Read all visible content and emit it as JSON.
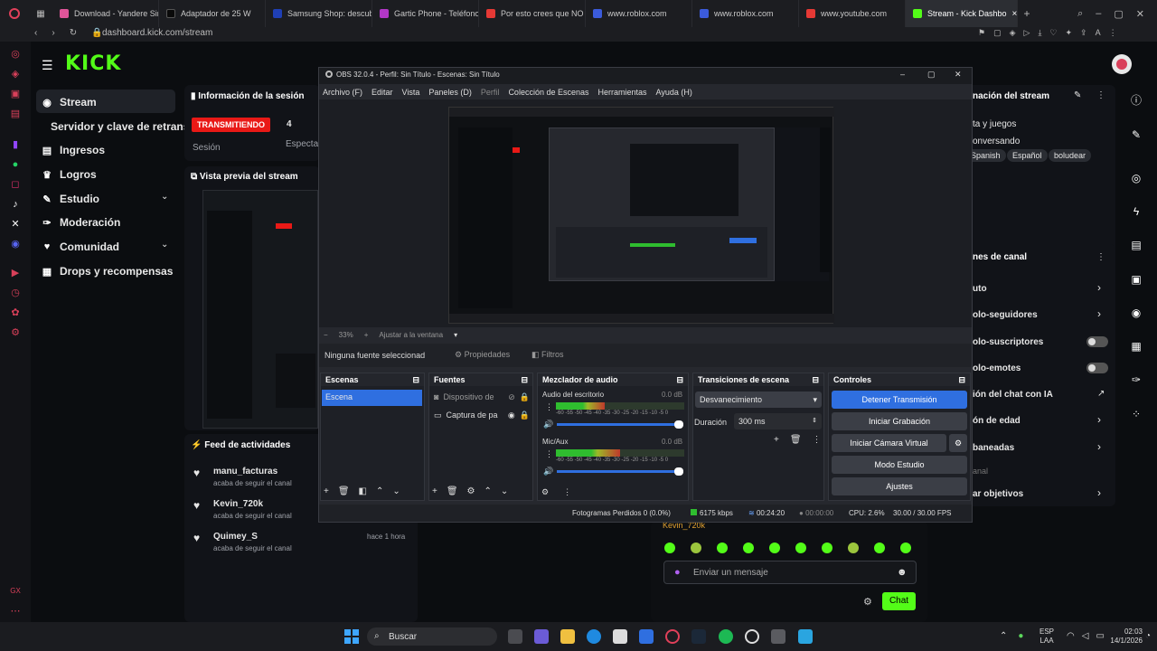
{
  "browser": {
    "tabs": [
      {
        "label": "Download - Yandere Sim",
        "color": "#e0559a"
      },
      {
        "label": "Adaptador de 25 W",
        "color": "#0a0a0a"
      },
      {
        "label": "Samsung Shop: descubr",
        "color": "#1f3fb5"
      },
      {
        "label": "Gartic Phone - Teléfono",
        "color": "#b237c7"
      },
      {
        "label": "Por esto crees que NO l",
        "color": "#e53935"
      },
      {
        "label": "www.roblox.com",
        "color": "#3b5bdb"
      },
      {
        "label": "www.roblox.com",
        "color": "#3b5bdb"
      },
      {
        "label": "www.youtube.com",
        "color": "#e53935"
      },
      {
        "label": "Stream - Kick Dashbo",
        "color": "#53fc18"
      }
    ],
    "url": "dashboard.kick.com/stream"
  },
  "kick": {
    "logo": "KICK",
    "nav": [
      {
        "label": "Stream",
        "icon": "broadcast-icon"
      },
      {
        "label": "Servidor y clave de retransm",
        "icon": ""
      },
      {
        "label": "Ingresos",
        "icon": "dollar-icon"
      },
      {
        "label": "Logros",
        "icon": "trophy-icon"
      },
      {
        "label": "Estudio",
        "icon": "pencil-icon"
      },
      {
        "label": "Moderación",
        "icon": "wrench-icon"
      },
      {
        "label": "Comunidad",
        "icon": "heart-icon"
      },
      {
        "label": "Drops y recompensas",
        "icon": "gift-icon"
      }
    ],
    "session": {
      "title": "Información de la sesión",
      "status": "TRANSMITIENDO",
      "label": "Sesión",
      "value": "4",
      "extra": "Especta"
    },
    "preview_title": "Vista previa del stream",
    "activity": {
      "title": "Feed de actividades",
      "items": [
        {
          "user": "manu_facturas",
          "action": "acaba de seguir el canal",
          "time": ""
        },
        {
          "user": "Kevin_720k",
          "action": "acaba de seguir el canal",
          "time": ""
        },
        {
          "user": "Quimey_S",
          "action": "acaba de seguir el canal",
          "time": "hace 1 hora"
        }
      ]
    },
    "right": {
      "info_title": "nación del stream",
      "category": "ta y juegos",
      "subtitle": "onversando",
      "tags": [
        "Spanish",
        "Español",
        "boludear"
      ],
      "settings_title": "nes de canal",
      "settings": [
        {
          "label": "uto",
          "control": "chevron"
        },
        {
          "label": "olo-seguidores",
          "control": "chevron"
        },
        {
          "label": "olo-suscriptores",
          "control": "toggle"
        },
        {
          "label": "olo-emotes",
          "control": "toggle"
        },
        {
          "label": "ión del chat con IA",
          "control": "link"
        },
        {
          "label": "ón de edad",
          "control": "chevron"
        },
        {
          "label": "baneadas",
          "control": "chevron"
        },
        {
          "label": "anal",
          "control": "none"
        },
        {
          "label": "ar objetivos",
          "control": "chevron"
        }
      ]
    },
    "chat": {
      "partial_user": "Kevin_720k",
      "placeholder": "Enviar un mensaje",
      "send": "Chat"
    }
  },
  "obs": {
    "title": "OBS 32.0.4 - Perfil: Sin Título - Escenas: Sin Título",
    "menu": [
      "Archivo (F)",
      "Editar",
      "Vista",
      "Paneles (D)",
      "Perfil",
      "Colección de Escenas",
      "Herramientas",
      "Ayuda (H)"
    ],
    "zoom": "33%",
    "fit": "Ajustar a la ventana",
    "no_source": "Ninguna fuente seleccionad",
    "properties": "Propiedades",
    "filters": "Filtros",
    "scenes": {
      "title": "Escenas",
      "items": [
        "Escena"
      ]
    },
    "sources": {
      "title": "Fuentes",
      "items": [
        "Dispositivo de",
        "Captura de pa"
      ]
    },
    "mixer": {
      "title": "Mezclador de audio",
      "channels": [
        {
          "name": "Audio del escritorio",
          "db": "0.0 dB",
          "level": 0.38
        },
        {
          "name": "Mic/Aux",
          "db": "0.0 dB",
          "level": 0.5
        }
      ],
      "scale": "-60 -55 -50 -45 -40 -35 -30 -25 -20 -15 -10 -5 0"
    },
    "transitions": {
      "title": "Transiciones de escena",
      "type": "Desvanecimiento",
      "duration_label": "Duración",
      "duration": "300 ms"
    },
    "controls": {
      "title": "Controles",
      "buttons": [
        "Detener Transmisión",
        "Iniciar Grabación",
        "Iniciar Cámara Virtual",
        "Modo Estudio",
        "Ajustes"
      ]
    },
    "status": {
      "dropped": "Fotogramas Perdidos 0 (0.0%)",
      "bitrate": "6175 kbps",
      "live_time": "00:24:20",
      "rec_time": "00:00:00",
      "cpu": "CPU: 2.6%",
      "fps": "30.00 / 30.00 FPS"
    }
  },
  "taskbar": {
    "search": "Buscar",
    "lang1": "ESP",
    "lang2": "LAA",
    "time": "02:03",
    "date": "14/1/2026"
  },
  "colors": {
    "kick_green": "#53fc18",
    "live_red": "#e91916",
    "obs_blue": "#2f6fe0"
  }
}
